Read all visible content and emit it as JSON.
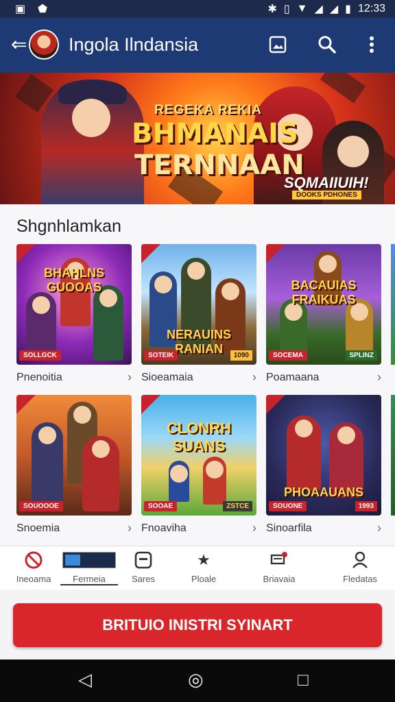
{
  "status_bar": {
    "time": "12:33",
    "left_icons": [
      "app-notification-icon",
      "shield-icon"
    ],
    "right_icons": [
      "bluetooth-icon",
      "vibrate-icon",
      "wifi-icon",
      "signal-icon",
      "signal-icon",
      "battery-icon"
    ]
  },
  "app_bar": {
    "title": "Ingola Ilndansia",
    "back_icon": "arrow-left-icon",
    "actions": [
      "image-icon",
      "search-icon",
      "more-vert-icon"
    ]
  },
  "hero": {
    "line1": "REGEKA REKIA",
    "line2": "BHMANAIS",
    "line3": "TERNNAAN",
    "badge_title": "SQMAIIUIH!",
    "badge_sub": "DOOKS PDHONES"
  },
  "section": {
    "heading": "Shgnhlamkan",
    "cards": [
      {
        "title": "BHAHLNS GUOOAS",
        "tag": "SOLLGCK",
        "price": "",
        "label": "Pnenoitia"
      },
      {
        "title": "NERAUINS RANIAN",
        "tag": "SOTEIK",
        "price": "1090",
        "label": "Sioeamaia"
      },
      {
        "title": "BACAUIAS FRAIKUAS",
        "tag": "SOCEMA",
        "price": "SPLINZ",
        "label": "Poamaana"
      },
      {
        "title": "",
        "tag": "SOUOOOE",
        "price": "",
        "label": "Snoemia"
      },
      {
        "title": "CLONRH SUANS",
        "tag": "SOOAE",
        "price": "ZSTCE",
        "label": "Fnoaviha"
      },
      {
        "title": "PHOAAUANS",
        "tag": "SOUONE",
        "price": "1993",
        "label": "Sinoarfila"
      }
    ]
  },
  "tabs": [
    {
      "label": "Ineoama",
      "icon": "no-symbol-icon"
    },
    {
      "label": "Fermeia",
      "icon": "tv-icon"
    },
    {
      "label": "Sares",
      "icon": "square-icon"
    },
    {
      "label": "Ploale",
      "icon": "star-icon"
    },
    {
      "label": "Briavaia",
      "icon": "cart-icon"
    },
    {
      "label": "Fledatas",
      "icon": "person-icon"
    }
  ],
  "cta": {
    "label": "BRITUIO INISTRI SYINART"
  },
  "nav": {
    "back": "◁",
    "home": "◎",
    "recents": "□"
  },
  "colors": {
    "app_bar": "#1e3a75",
    "accent": "#d9262a"
  }
}
